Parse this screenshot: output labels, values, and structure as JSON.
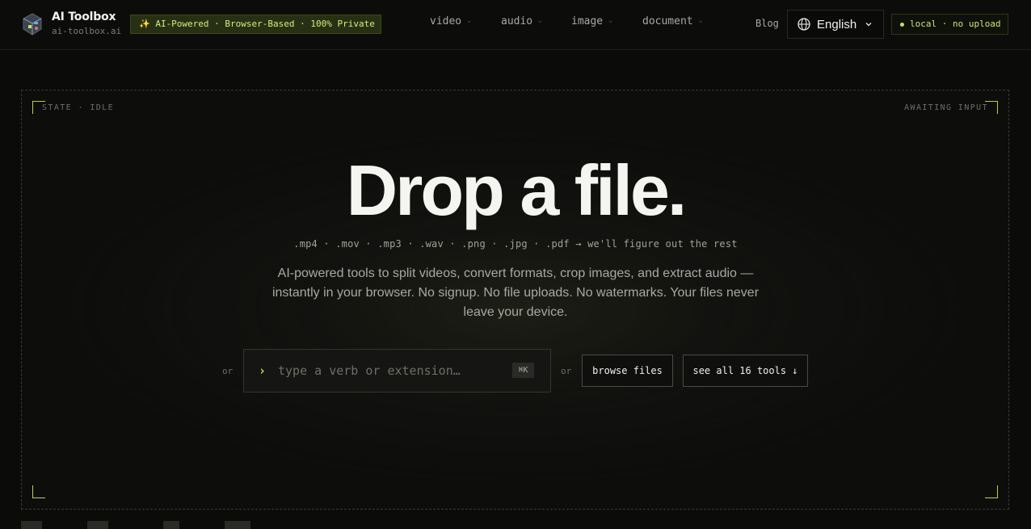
{
  "brand": {
    "title": "AI Toolbox",
    "domain": "ai-toolbox.ai"
  },
  "badge": "✨ AI-Powered · Browser-Based · 100% Private",
  "nav": [
    {
      "label": "video"
    },
    {
      "label": "audio"
    },
    {
      "label": "image"
    },
    {
      "label": "document"
    }
  ],
  "blog_label": "Blog",
  "language": {
    "selected": "English"
  },
  "status": "local · no upload",
  "dropzone": {
    "state_label": "STATE · IDLE",
    "awaiting_label": "AWAITING INPUT",
    "title": "Drop a file.",
    "extensions_line": ".mp4 · .mov · .mp3 · .wav · .png · .jpg · .pdf → we'll figure out the rest",
    "description": "AI-powered tools to split videos, convert formats, crop images, and extract audio — instantly in your browser. No signup. No file uploads. No watermarks. Your files never leave your device.",
    "or_left": "or",
    "or_right": "or",
    "search": {
      "prompt": "›",
      "value": "",
      "placeholder": "type a verb or extension…",
      "shortcut": "⌘K"
    },
    "browse_label": "browse files",
    "tools_label": "see all 16 tools ↓"
  },
  "colors": {
    "accent": "#c7e25c",
    "background": "#0b0b0a",
    "badge_bg": "#283014"
  }
}
